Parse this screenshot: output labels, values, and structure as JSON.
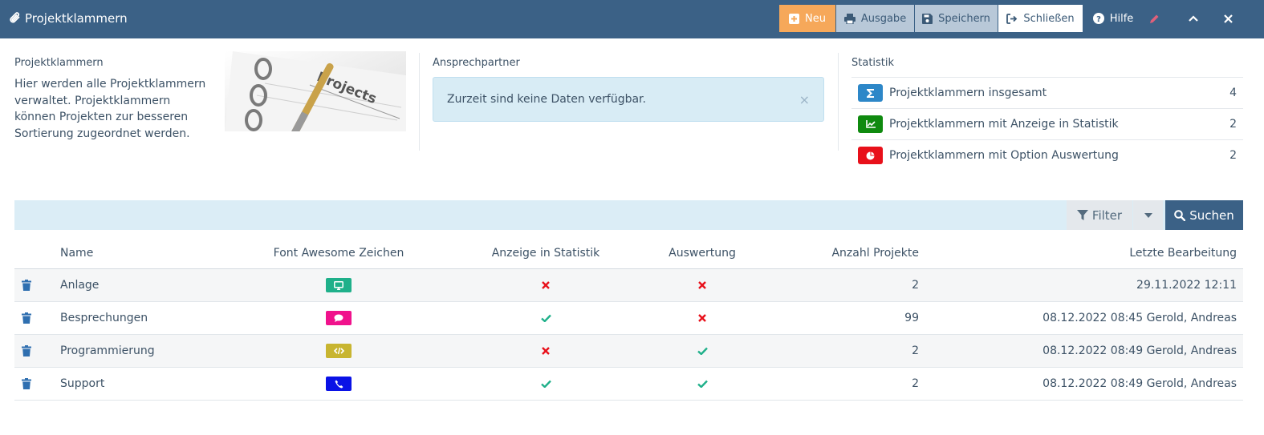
{
  "header": {
    "title": "Projektklammern",
    "buttons": {
      "neu": "Neu",
      "ausgabe": "Ausgabe",
      "speichern": "Speichern",
      "schliessen": "Schließen",
      "hilfe": "Hilfe"
    }
  },
  "info": {
    "label": "Projektklammern",
    "text": "Hier werden alle Projektklammern verwaltet. Projektklammern können Projekten zur besseren Sortierung zugeordnet werden.",
    "image_label": "Projects"
  },
  "contact": {
    "label": "Ansprechpartner",
    "alert": "Zurzeit sind keine Daten verfügbar.",
    "alert_close": "×"
  },
  "stats": {
    "label": "Statistik",
    "items": [
      {
        "label": "Projektklammern insgesamt",
        "value": "4",
        "icon": "sigma-icon",
        "color": "#2d87c8"
      },
      {
        "label": "Projektklammern mit Anzeige in Statistik",
        "value": "2",
        "icon": "line-chart-icon",
        "color": "#0f8a0f"
      },
      {
        "label": "Projektklammern mit Option Auswertung",
        "value": "2",
        "icon": "pie-chart-icon",
        "color": "#e8101a"
      }
    ]
  },
  "filterbar": {
    "filter_label": "Filter",
    "search_label": "Suchen"
  },
  "table": {
    "columns": {
      "name": "Name",
      "icon": "Font Awesome Zeichen",
      "statistik": "Anzeige in Statistik",
      "auswertung": "Auswertung",
      "anzahl": "Anzahl Projekte",
      "letzte": "Letzte Bearbeitung"
    },
    "rows": [
      {
        "name": "Anlage",
        "icon": "desktop-icon",
        "color": "#1fb08a",
        "statistik": false,
        "auswertung": false,
        "anzahl": "2",
        "letzte": "29.11.2022 12:11"
      },
      {
        "name": "Besprechungen",
        "icon": "comment-icon",
        "color": "#f0128c",
        "statistik": true,
        "auswertung": false,
        "anzahl": "99",
        "letzte": "08.12.2022 08:45 Gerold, Andreas"
      },
      {
        "name": "Programmierung",
        "icon": "code-icon",
        "color": "#c8b530",
        "statistik": false,
        "auswertung": true,
        "anzahl": "2",
        "letzte": "08.12.2022 08:49 Gerold, Andreas"
      },
      {
        "name": "Support",
        "icon": "phone-icon",
        "color": "#0a12e6",
        "statistik": true,
        "auswertung": true,
        "anzahl": "2",
        "letzte": "08.12.2022 08:49 Gerold, Andreas"
      }
    ]
  },
  "colors": {
    "header_bg": "#3b6186",
    "check": "#1fb08a",
    "cross": "#e8101a",
    "trash": "#2f6fb0"
  }
}
